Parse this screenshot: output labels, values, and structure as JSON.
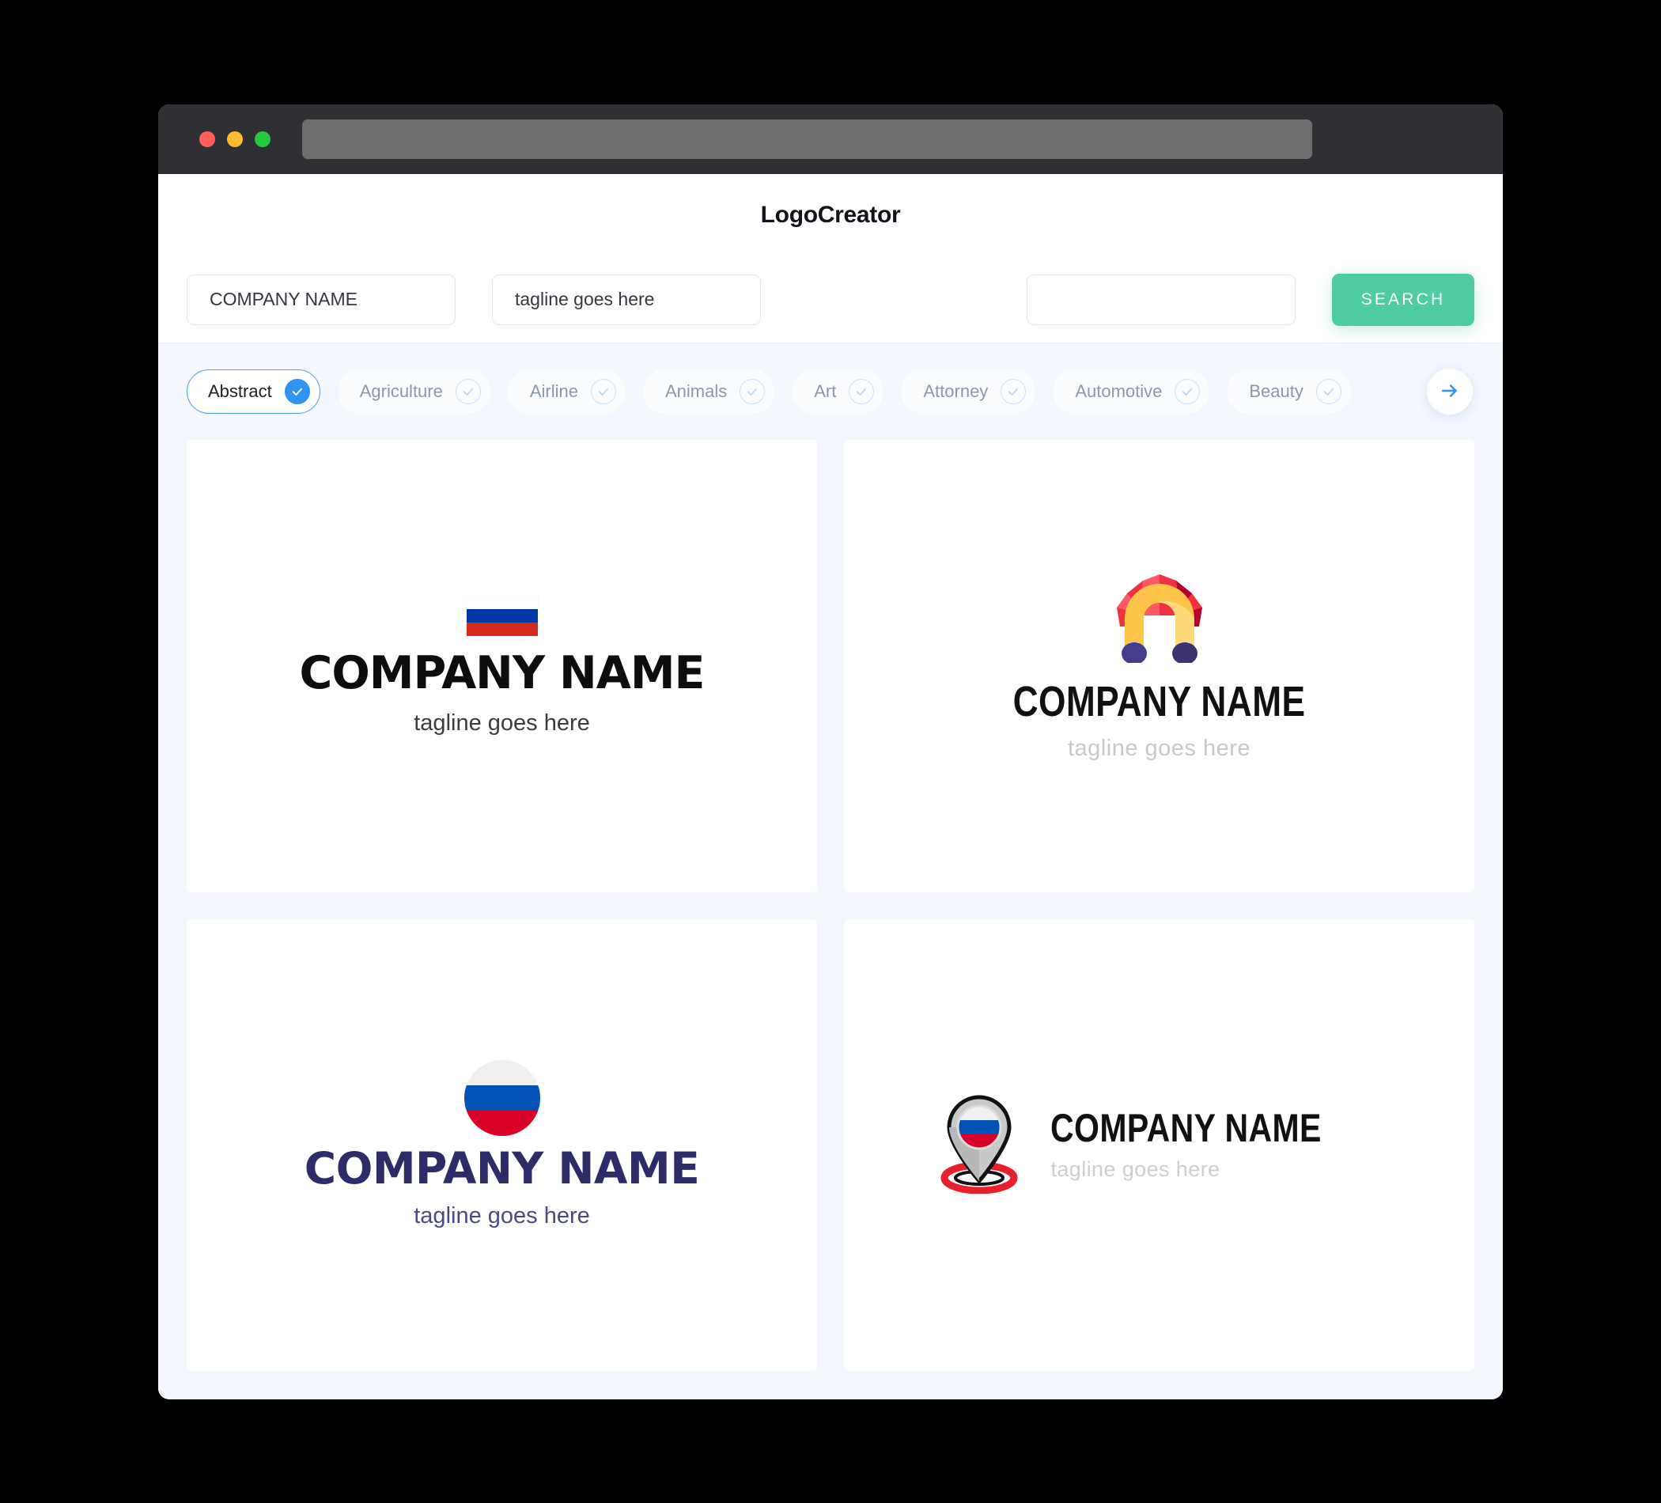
{
  "browser": {
    "traffic_lights": [
      "close",
      "minimize",
      "zoom"
    ],
    "url_bar_value": "",
    "colors": {
      "chrome": "#2E3033",
      "url_bar": "#6E6E6E",
      "red": "#FF5F56",
      "yellow": "#FFBD2E",
      "green": "#27C93F"
    }
  },
  "header": {
    "title": "LogoCreator"
  },
  "search": {
    "company_input_value": "COMPANY NAME",
    "company_input_placeholder": "COMPANY NAME",
    "tagline_input_value": "tagline goes here",
    "tagline_input_placeholder": "tagline goes here",
    "third_input_value": "",
    "third_input_placeholder": "",
    "search_button_label": "SEARCH",
    "accent_color": "#4FCCA1"
  },
  "categories": {
    "next_icon": "arrow-right-icon",
    "accent_selected": "#2F95F0",
    "items": [
      {
        "label": "Abstract",
        "selected": true,
        "check_icon": "check-icon"
      },
      {
        "label": "Agriculture",
        "selected": false,
        "check_icon": "check-icon"
      },
      {
        "label": "Airline",
        "selected": false,
        "check_icon": "check-icon"
      },
      {
        "label": "Animals",
        "selected": false,
        "check_icon": "check-icon"
      },
      {
        "label": "Art",
        "selected": false,
        "check_icon": "check-icon"
      },
      {
        "label": "Attorney",
        "selected": false,
        "check_icon": "check-icon"
      },
      {
        "label": "Automotive",
        "selected": false,
        "check_icon": "check-icon"
      },
      {
        "label": "Beauty",
        "selected": false,
        "check_icon": "check-icon"
      }
    ]
  },
  "results": {
    "cards": [
      {
        "id": "logo-card-1",
        "mark": "russian-flag-bar-icon",
        "name": "COMPANY NAME",
        "tagline": "tagline goes here",
        "name_color": "#0D0D0D",
        "tagline_color": "#3C3C3C",
        "mark_colors": [
          "#FFFFFF",
          "#0039A6",
          "#D52B1E"
        ]
      },
      {
        "id": "logo-card-2",
        "mark": "arch-fan-abstract-icon",
        "name": "COMPANY NAME",
        "tagline": "tagline goes here",
        "name_color": "#111111",
        "tagline_color": "#C9C9C9",
        "mark_colors": [
          "#FFC64B",
          "#FFD87A",
          "#F73A4B",
          "#FF6A6A",
          "#B3002D",
          "#453D8C",
          "#3B3470"
        ]
      },
      {
        "id": "logo-card-3",
        "mark": "russian-flag-circle-icon",
        "name": "COMPANY NAME",
        "tagline": "tagline goes here",
        "name_color": "#2D2B68",
        "tagline_color": "#4B4A86",
        "mark_colors": [
          "#F0F0F0",
          "#0052B4",
          "#D80027"
        ]
      },
      {
        "id": "logo-card-4",
        "mark": "map-pin-flag-icon",
        "name": "COMPANY NAME",
        "tagline": "tagline goes here",
        "name_color": "#111111",
        "tagline_color": "#CFCFCF",
        "mark_colors": [
          "#C9C9C9",
          "#F0F0F0",
          "#0052B4",
          "#D80027",
          "#E8202A"
        ]
      }
    ]
  }
}
